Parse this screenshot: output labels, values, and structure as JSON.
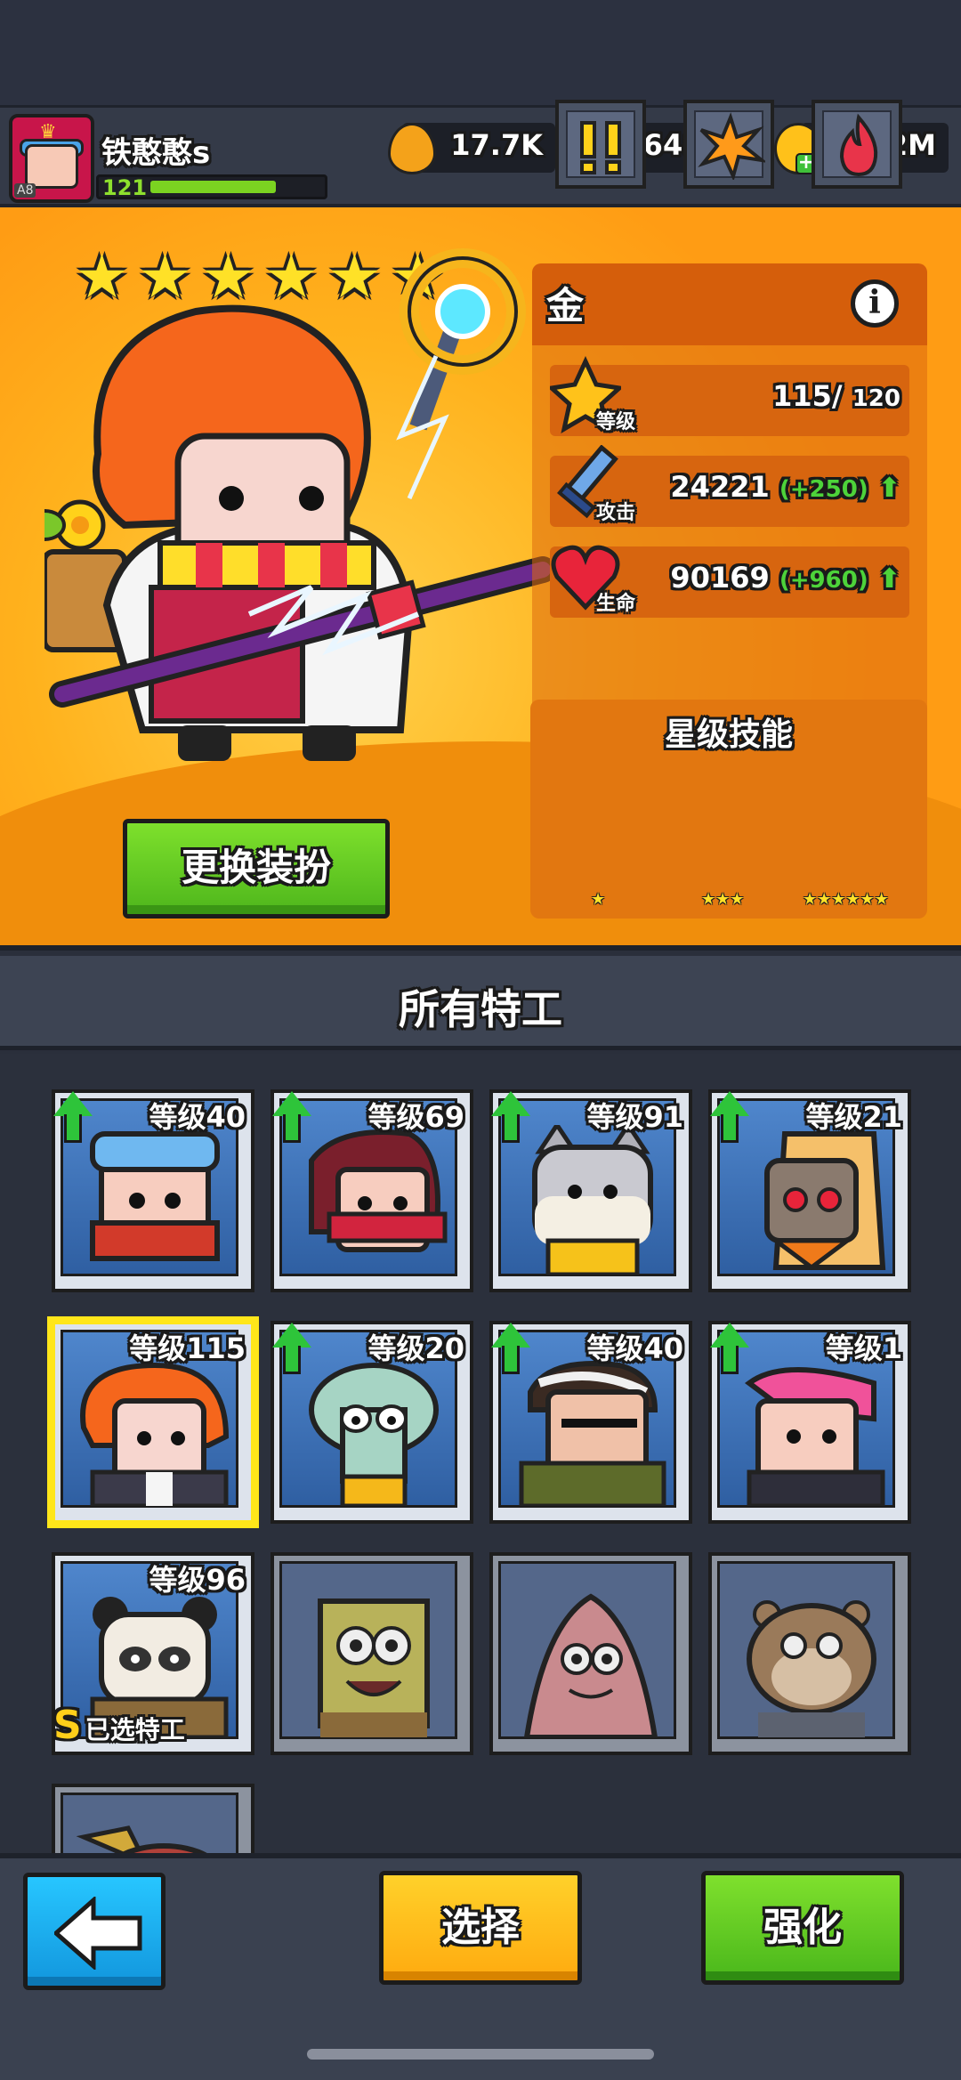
{
  "player": {
    "name": "铁憨憨s",
    "level": "121",
    "avatar_tag": "A8",
    "xp_fraction": 0.74
  },
  "resources": [
    {
      "name": "drop-icon",
      "value": "17.7K"
    },
    {
      "name": "gem-icon",
      "value": "64841"
    },
    {
      "name": "coin-icon",
      "value": "179.2M"
    }
  ],
  "hero": {
    "stars": 6,
    "name": "金",
    "level_label": "等级",
    "level_value": "115/",
    "level_max": "120",
    "attack_label": "攻击",
    "attack_value": "24221",
    "attack_bonus": "(+250)",
    "hp_label": "生命",
    "hp_value": "90169",
    "hp_bonus": "(+960)",
    "star_skills_title": "星级技能",
    "skill_stars": [
      "★",
      "★★★",
      "★★★★★★"
    ],
    "change_outfit_button": "更换装扮"
  },
  "agents_title": "所有特工",
  "agents": [
    {
      "level": "等级40",
      "upgrade": true
    },
    {
      "level": "等级69",
      "upgrade": true
    },
    {
      "level": "等级91",
      "upgrade": true
    },
    {
      "level": "等级21",
      "upgrade": true
    },
    {
      "level": "等级115",
      "upgrade": false,
      "selected": true
    },
    {
      "level": "等级20",
      "upgrade": true
    },
    {
      "level": "等级40",
      "upgrade": true
    },
    {
      "level": "等级1",
      "upgrade": true
    },
    {
      "level": "等级96",
      "upgrade": false,
      "tag": "已选特工",
      "badge": "S"
    }
  ],
  "buttons": {
    "select": "选择",
    "enhance": "强化"
  },
  "colors": {
    "accent_orange": "#ff9c14",
    "accent_green": "#4dd33a",
    "accent_yellow": "#ffd12a",
    "accent_blue": "#27c6ff"
  }
}
